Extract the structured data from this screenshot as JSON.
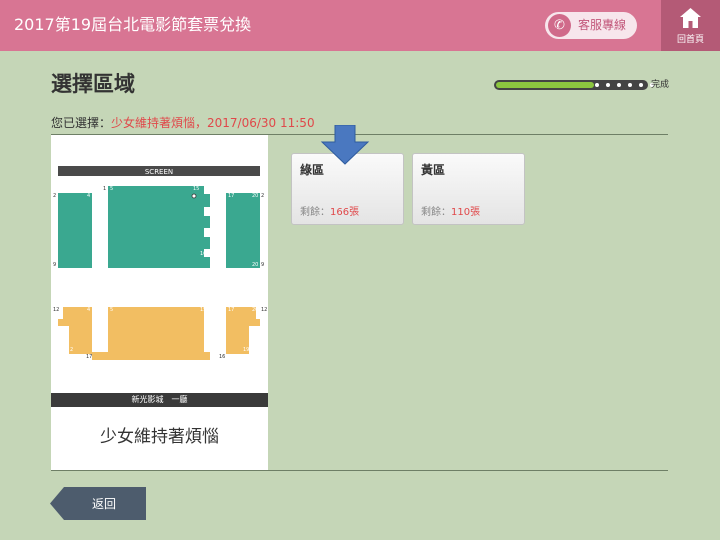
{
  "header": {
    "title": "2017第19屆台北電影節套票兌換",
    "hotline_label": "客服專線",
    "home_label": "回首頁"
  },
  "page": {
    "title": "選擇區域",
    "progress_label": "完成",
    "progress": 0.65
  },
  "selection": {
    "prefix": "您已選擇：",
    "value": "少女維持著煩惱，2017/06/30 11:50"
  },
  "seat_map": {
    "screen_label": "SCREEN",
    "venue": "新光影城　一廳",
    "film": "少女維持著煩惱",
    "green_color": "#3aa890",
    "yellow_color": "#f2be62",
    "row_labels": [
      "1",
      "5",
      "15",
      "2",
      "4",
      "17",
      "20",
      "2",
      "9",
      "16",
      "20",
      "9",
      "12",
      "4",
      "5",
      "15",
      "17",
      "20",
      "12",
      "2",
      "17",
      "16",
      "19"
    ]
  },
  "zones": [
    {
      "name": "綠區",
      "remain_prefix": "剩餘：",
      "remain_count": "166張"
    },
    {
      "name": "黃區",
      "remain_prefix": "剩餘：",
      "remain_count": "110張"
    }
  ],
  "footer": {
    "back_label": "返回"
  }
}
